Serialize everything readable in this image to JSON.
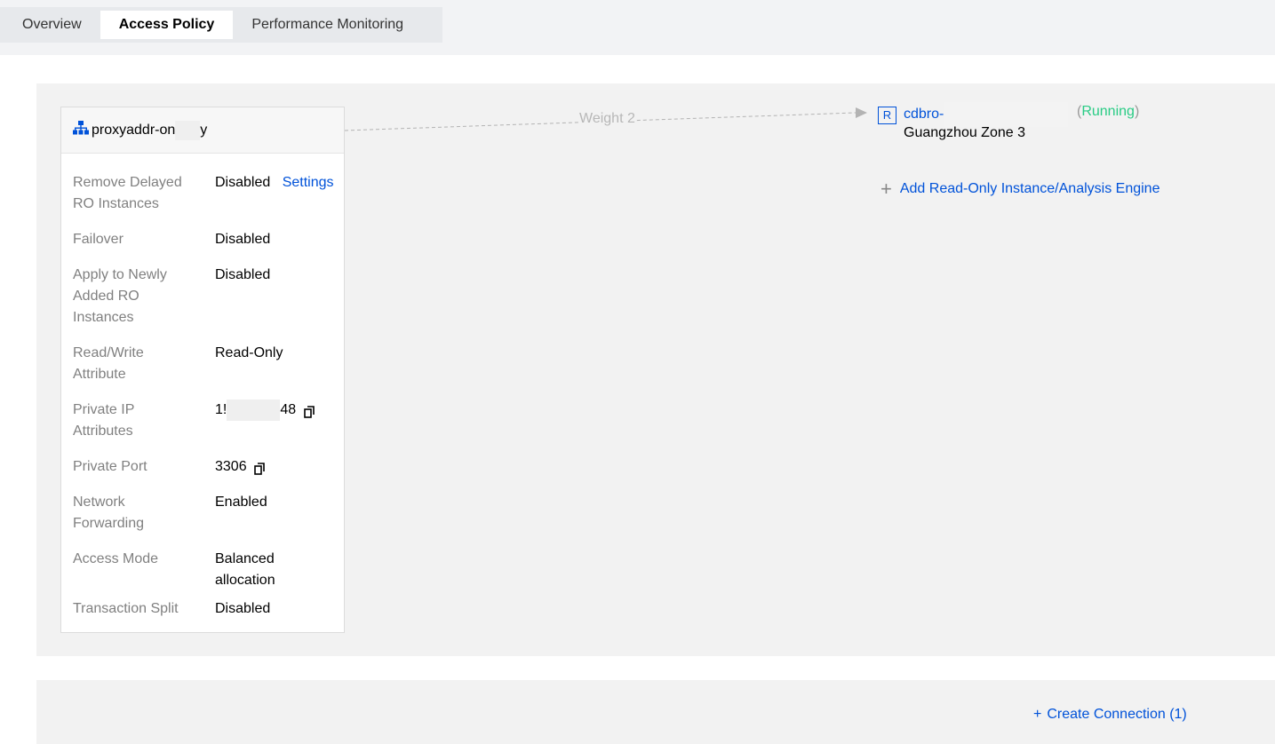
{
  "tabs": [
    {
      "label": "Overview"
    },
    {
      "label": "Access Policy"
    },
    {
      "label": "Performance Monitoring"
    }
  ],
  "proxy": {
    "name_prefix": "proxyaddr-on",
    "name_suffix": "y"
  },
  "settings": [
    {
      "label": "Remove Delayed RO Instances",
      "value": "Disabled",
      "link": "Settings"
    },
    {
      "label": "Failover",
      "value": "Disabled"
    },
    {
      "label": "Apply to Newly Added RO Instances",
      "value": "Disabled"
    },
    {
      "label": "Read/Write Attribute",
      "value": "Read-Only"
    },
    {
      "label": "Private IP Attributes",
      "value_prefix": "1!",
      "value_suffix": "48"
    },
    {
      "label": "Private Port",
      "value": "3306"
    },
    {
      "label": "Network Forwarding",
      "value": "Enabled"
    },
    {
      "label": "Access Mode",
      "value": "Balanced allocation"
    },
    {
      "label": "Transaction Split",
      "value": "Disabled"
    }
  ],
  "connector": {
    "weight_label": "Weight 2"
  },
  "ro_instance": {
    "badge": "R",
    "name_prefix": "cdbro-",
    "status": "Running",
    "zone": "Guangzhou Zone 3"
  },
  "add_ro_label": "Add Read-Only Instance/Analysis Engine",
  "create_connection_label": "Create Connection (1)",
  "colors": {
    "link": "#0052d9",
    "running": "#29cc85",
    "label": "#808080"
  },
  "icons": {
    "proxy": "network-topology-icon",
    "copy": "copy-icon",
    "add": "plus-icon"
  }
}
